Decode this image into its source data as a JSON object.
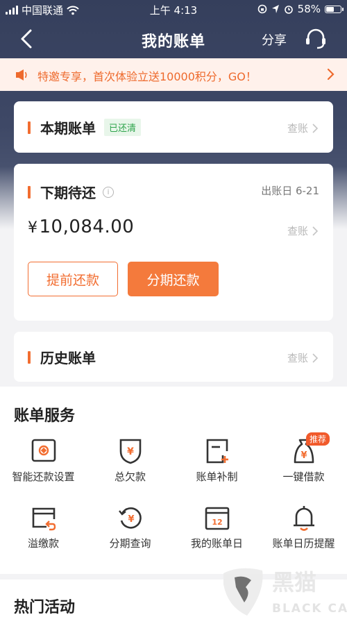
{
  "status_bar": {
    "carrier": "中国联通",
    "time": "上午 4:13",
    "battery": "58%"
  },
  "nav": {
    "title": "我的账单",
    "share_label": "分享"
  },
  "notice": {
    "text": "特邀专享，首次体验立送10000积分，GO！"
  },
  "current_bill": {
    "title": "本期账单",
    "badge": "已还清",
    "view_label": "查账"
  },
  "next_bill": {
    "title": "下期待还",
    "due_date": "出账日 6-21",
    "currency": "¥",
    "amount": "10,084.00",
    "view_label": "查账",
    "prepay_button": "提前还款",
    "installment_button": "分期还款"
  },
  "history_bill": {
    "title": "历史账单",
    "view_label": "查账"
  },
  "services": {
    "title": "账单服务",
    "recommend_badge": "推荐",
    "items": [
      {
        "label": "智能还款设置",
        "icon": "smart-repay-icon"
      },
      {
        "label": "总欠款",
        "icon": "total-debt-icon"
      },
      {
        "label": "账单补制",
        "icon": "bill-reissue-icon"
      },
      {
        "label": "一键借款",
        "icon": "one-click-loan-icon"
      },
      {
        "label": "溢缴款",
        "icon": "overpayment-icon"
      },
      {
        "label": "分期查询",
        "icon": "installment-query-icon"
      },
      {
        "label": "我的账单日",
        "icon": "bill-day-icon",
        "calendar_day": "12"
      },
      {
        "label": "账单日历提醒",
        "icon": "bell-icon"
      }
    ]
  },
  "hot_activities": {
    "title": "热门活动"
  },
  "watermark": {
    "cn": "黑猫",
    "en": "BLACK CAT"
  },
  "colors": {
    "accent": "#f26d30",
    "header_bg": "#3a4462",
    "paid_green": "#2fa44c"
  }
}
